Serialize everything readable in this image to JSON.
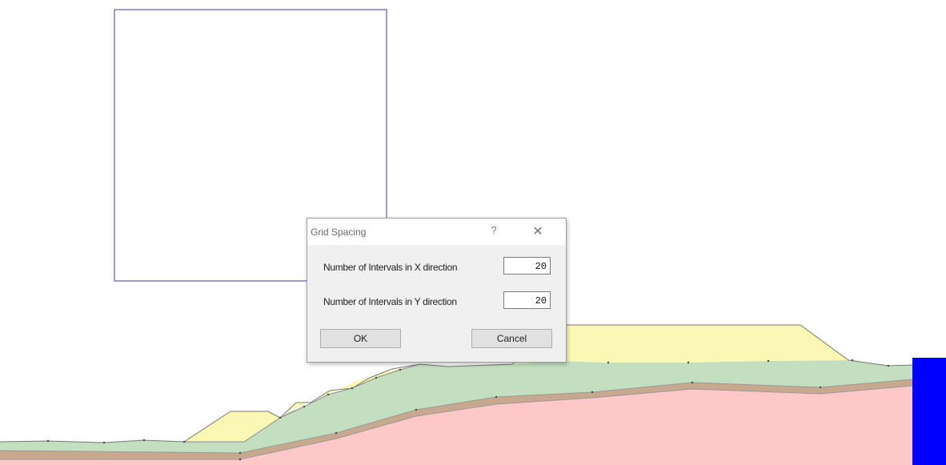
{
  "dialog": {
    "title": "Grid Spacing",
    "help_glyph": "?",
    "close_glyph": "✕",
    "x_label": "Number of Intervals in X direction",
    "x_value": "20",
    "y_label": "Number of Intervals in Y direction",
    "y_value": "20",
    "ok_label": "OK",
    "cancel_label": "Cancel"
  },
  "colors": {
    "grid_box": "#3a3aa8",
    "foundation": "#ffc8c8",
    "clay_band": "#c8a98f",
    "embankment": "#c4dfc0",
    "fill": "#fbf8b6",
    "water": "#0000ff"
  }
}
